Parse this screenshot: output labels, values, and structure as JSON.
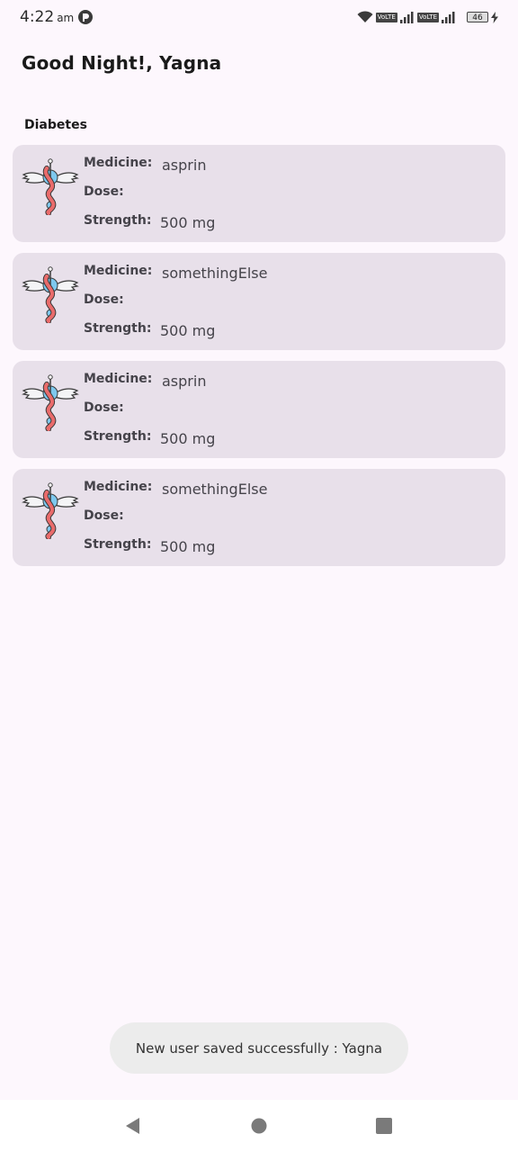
{
  "status_bar": {
    "time": "4:22",
    "ampm": "am",
    "volte_1": "VoLTE",
    "volte_2": "VoLTE",
    "battery": "46"
  },
  "header": {
    "greeting": "Good Night!, Yagna"
  },
  "section": {
    "title": "Diabetes"
  },
  "labels": {
    "medicine": "Medicine:",
    "dose": "Dose:",
    "strength": "Strength:"
  },
  "medicines": [
    {
      "name": "asprin",
      "dose": "",
      "strength": "500 mg"
    },
    {
      "name": "somethingElse",
      "dose": "",
      "strength": "500 mg"
    },
    {
      "name": "asprin",
      "dose": "",
      "strength": "500 mg"
    },
    {
      "name": "somethingElse",
      "dose": "",
      "strength": "500 mg"
    }
  ],
  "toast": {
    "message": "New user saved successfully : Yagna"
  },
  "icons": {
    "card": "caduceus-icon",
    "nav_back": "back-triangle-icon",
    "nav_home": "home-circle-icon",
    "nav_recents": "recents-square-icon"
  },
  "colors": {
    "background": "#fdf7fd",
    "card": "#e8e0ea",
    "toast": "#ececec",
    "snake": "#e96b6b",
    "orb": "#7ec8ee"
  }
}
